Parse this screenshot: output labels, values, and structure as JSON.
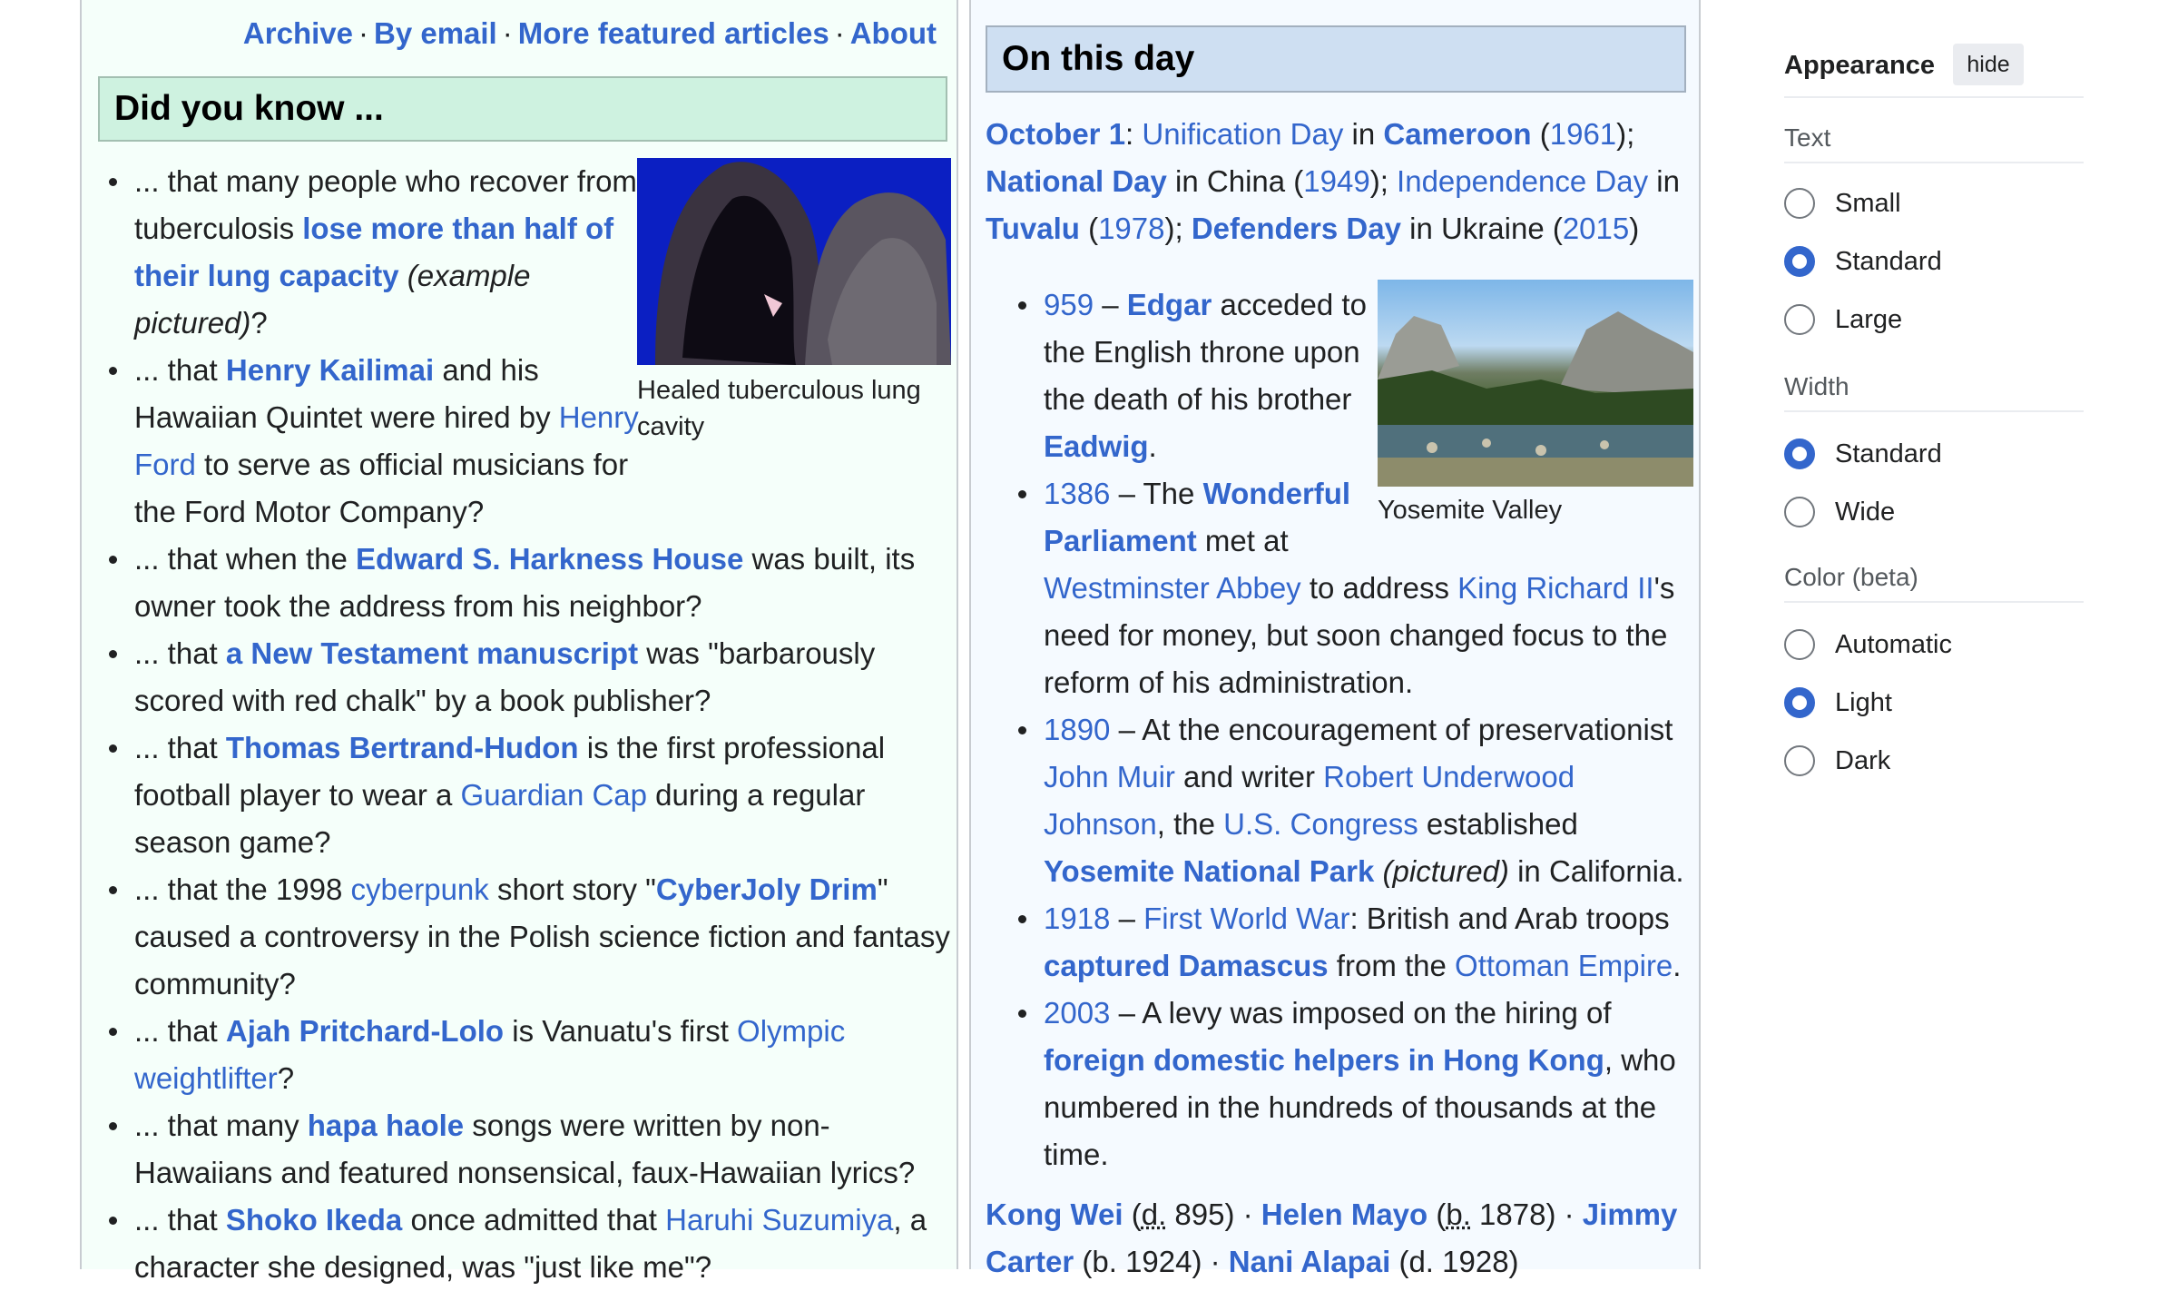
{
  "left": {
    "nav": [
      {
        "label": "Archive"
      },
      {
        "label": "By email"
      },
      {
        "label": "More featured articles"
      },
      {
        "label": "About"
      }
    ],
    "dyk_title": "Did you know ...",
    "figure_caption": "Healed tuberculous lung cavity",
    "items": [
      [
        "... that many people who recover from tuberculosis ",
        "lose more than half of their lung capacity",
        " ",
        "(example pictured)",
        "?"
      ],
      [
        "... that ",
        "Henry Kailimai",
        " and his Hawaiian Quintet were hired by ",
        "Henry Ford",
        " to serve as official musicians for the Ford Motor Company?"
      ],
      [
        "... that when the ",
        "Edward S. Harkness House",
        " was built, its owner took the address from his neighbor?"
      ],
      [
        "... that ",
        "a New Testament manuscript",
        " was \"barbarously scored with red chalk\" by a book publisher?"
      ],
      [
        "... that ",
        "Thomas Bertrand-Hudon",
        " is the first professional football player to wear a ",
        "Guardian Cap",
        " during a regular season game?"
      ],
      [
        "... that the 1998 ",
        "cyberpunk",
        " short story \"",
        "CyberJoly Drim",
        "\" caused a controversy in the Polish science fiction and fantasy community?"
      ],
      [
        "... that ",
        "Ajah Pritchard-Lolo",
        " is Vanuatu's first ",
        "Olympic weightlifter",
        "?"
      ],
      [
        "... that many ",
        "hapa haole",
        " songs were written by non-Hawaiians and featured nonsensical, faux-Hawaiian lyrics?"
      ],
      [
        "... that ",
        "Shoko Ikeda",
        " once admitted that ",
        "Haruhi Suzumiya",
        ", a character she designed, was \"just like me\"?"
      ]
    ]
  },
  "right": {
    "otd_title": "On this day",
    "intro": [
      "October 1",
      ": ",
      "Unification Day",
      " in ",
      "Cameroon",
      " (",
      "1961",
      "); ",
      "National Day",
      " in China (",
      "1949",
      "); ",
      "Independence Day",
      " in ",
      "Tuvalu",
      " (",
      "1978",
      "); ",
      "Defenders Day",
      " in Ukraine (",
      "2015",
      ")"
    ],
    "figure_caption": "Yosemite Valley",
    "events": [
      [
        "959",
        " – ",
        "Edgar",
        " acceded to the English throne upon the death of his brother ",
        "Eadwig",
        "."
      ],
      [
        "1386",
        " – The ",
        "Wonderful Parliament",
        " met at ",
        "Westminster Abbey",
        " to address ",
        "King Richard II",
        "'s need for money, but soon changed focus to the reform of his administration."
      ],
      [
        "1890",
        " – At the encouragement of preservationist ",
        "John Muir",
        " and writer ",
        "Robert Underwood Johnson",
        ", the ",
        "U.S. Congress",
        " established ",
        "Yosemite National Park",
        " ",
        "(pictured)",
        " in California."
      ],
      [
        "1918",
        " – ",
        "First World War",
        ": British and Arab troops ",
        "captured Damascus",
        " from the ",
        "Ottoman Empire",
        "."
      ],
      [
        "2003",
        " – A levy was imposed on the hiring of ",
        "foreign domestic helpers in Hong Kong",
        ", who numbered in the hundreds of thousands at the time."
      ]
    ],
    "deaths": [
      "Kong Wei",
      " (",
      "d.",
      " 895) · ",
      "Helen Mayo",
      " (",
      "b.",
      " 1878) · ",
      "Jimmy Carter",
      " (b. 1924) · ",
      "Nani Alapai",
      " (d. 1928)"
    ]
  },
  "appearance": {
    "title": "Appearance",
    "hide_label": "hide",
    "sections": [
      {
        "label": "Text",
        "options": [
          "Small",
          "Standard",
          "Large"
        ],
        "selected": "Standard"
      },
      {
        "label": "Width",
        "options": [
          "Standard",
          "Wide"
        ],
        "selected": "Standard"
      },
      {
        "label": "Color (beta)",
        "options": [
          "Automatic",
          "Light",
          "Dark"
        ],
        "selected": "Light"
      }
    ]
  },
  "colors": {
    "link": "#3366cc",
    "dyk_header": "#cef2e0",
    "otd_header": "#cedff2",
    "radio_on": "#3366cc"
  }
}
